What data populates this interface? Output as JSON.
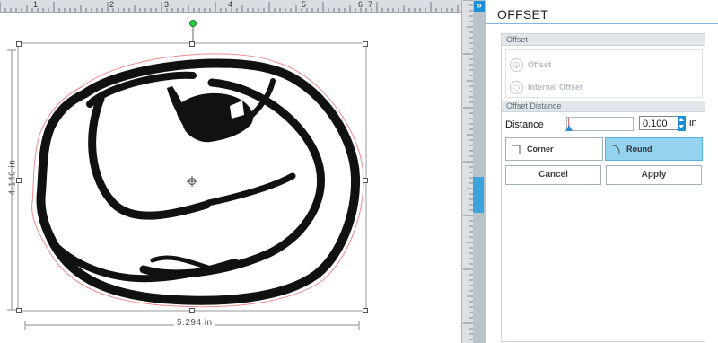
{
  "ruler": {
    "numbers": [
      "1",
      "2",
      "3",
      "4",
      "5",
      "6",
      "7"
    ]
  },
  "canvas": {
    "height_label": "4.140 in",
    "width_label": "5.294 in",
    "collapse_icon": "»"
  },
  "panel": {
    "title": "OFFSET",
    "offset_section": "Offset",
    "offset_option": "Offset",
    "internal_offset_option": "Internal Offset",
    "distance_section": "Offset Distance",
    "distance_label": "Distance",
    "distance_value": "0.100",
    "unit": "in",
    "corner_label": "Corner",
    "round_label": "Round",
    "cancel_label": "Cancel",
    "apply_label": "Apply",
    "selected_corner": "Round"
  },
  "colors": {
    "accent": "#1d8fd6",
    "round_selected": "#94d3ee",
    "offset_line": "#f08a8a"
  }
}
